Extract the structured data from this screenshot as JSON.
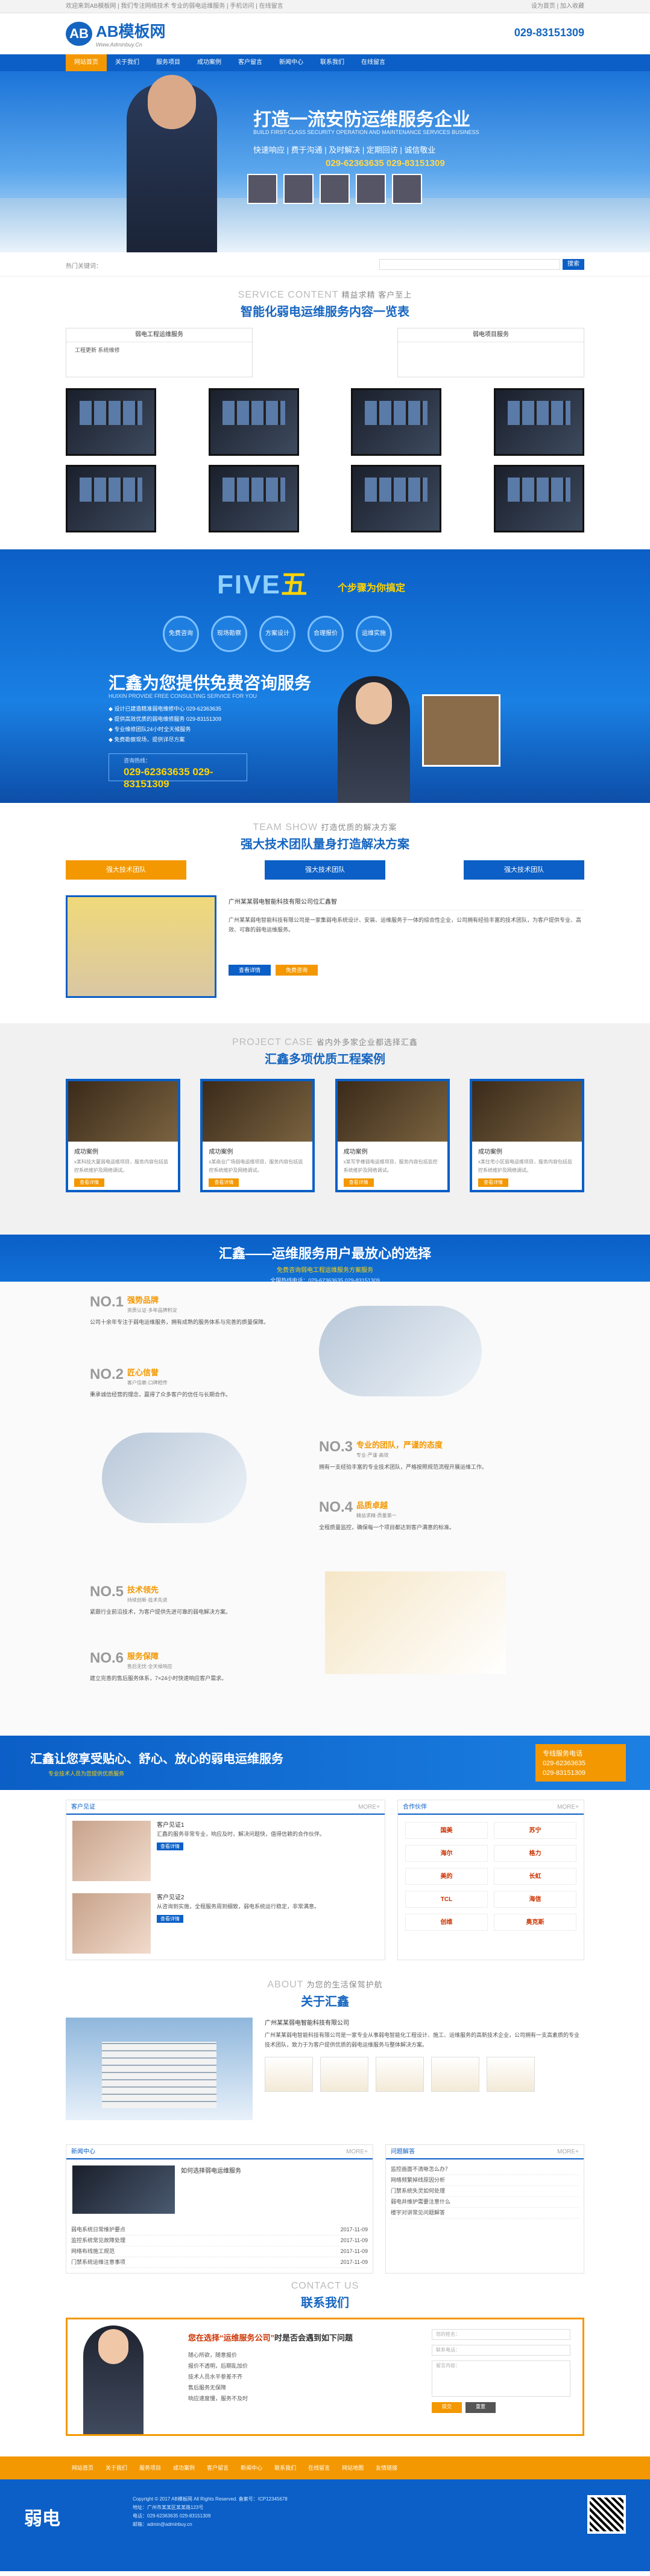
{
  "topbar": {
    "left": "欢迎来到AB模板网 | 我们专注网络技术 专业的弱电运维服务 | 手机访问 | 在线留言",
    "right": "设为首页 | 加入收藏"
  },
  "header": {
    "logo_text": "AB模板网",
    "logo_mark": "AB",
    "logo_sub": "Www.Adminbuy.Cn",
    "hotline": "029-83151309"
  },
  "nav": [
    "网站首页",
    "关于我们",
    "服务项目",
    "成功案例",
    "客户留言",
    "新闻中心",
    "联系我们",
    "在线留言"
  ],
  "banner": {
    "title": "打造一流安防运维服务企业",
    "subtitle": "BUILD FIRST-CLASS SECURITY OPERATION AND MAINTENANCE SERVICES BUSINESS",
    "features": "快速响应 | 费于沟通 | 及时解决 | 定期回访 | 诚信敬业",
    "phone": "029-62363635  029-83151309"
  },
  "search": {
    "label": "热门关键词：",
    "button": "搜索"
  },
  "service": {
    "en": "SERVICE CONTENT",
    "en_suffix": "精益求精 客户至上",
    "cn": "智能化弱电运维服务内容一览表",
    "col1": {
      "title": "弱电工程运维服务",
      "items": "工程更新    系统维修"
    },
    "col2": {
      "title": "弱电项目服务",
      "items": ""
    }
  },
  "five": {
    "big": "FIVE",
    "wu": "五",
    "line1": "个步骤为你搞定",
    "tag": "弱电运维服务",
    "steps": [
      "免费咨询",
      "现场勘察",
      "方案设计",
      "合理报价",
      "运维实施"
    ],
    "title": "汇鑫为您提供免费咨询服务",
    "title_en": "HUIXIN PROVIDE FREE CONSULTING SERVICE FOR YOU",
    "list": [
      "◆ 设计已建造精准弱电维修中心 029-62363635",
      "◆ 提供高效优质的弱电维修服务 029-83151309",
      "◆ 专业维修团队24小时全天候服务",
      "◆ 免费勘察现场，提供详尽方案"
    ],
    "tel_label": "咨询热线：",
    "tel": "029-62363635  029-83151309"
  },
  "team": {
    "en": "TEAM SHOW",
    "en_suffix": "打造优质的解决方案",
    "cn": "强大技术团队量身打造解决方案",
    "tabs": [
      "强大技术团队",
      "强大技术团队",
      "强大技术团队"
    ],
    "company": "广州某某弱电智能科技有限公司位汇鑫智",
    "desc": "广州某某弱电智能科技有限公司是一家集弱电系统设计、安装、运维服务于一体的综合性企业，公司拥有经验丰富的技术团队，为客户提供专业、高效、可靠的弱电运维服务。",
    "btn1": "查看详情",
    "btn2": "免费咨询"
  },
  "cases": {
    "en": "PROJECT CASE",
    "en_suffix": "省内外多家企业都选择汇鑫",
    "cn": "汇鑫多项优质工程案例",
    "items": [
      {
        "title": "成功案例",
        "desc": "x某科技大厦弱电运维项目，服务内容包括监控系统维护及网络调试。"
      },
      {
        "title": "成功案例",
        "desc": "x某商业广场弱电运维项目，服务内容包括监控系统维护及网络调试。"
      },
      {
        "title": "成功案例",
        "desc": "x某写字楼弱电运维项目，服务内容包括监控系统维护及网络调试。"
      },
      {
        "title": "成功案例",
        "desc": "x某住宅小区弱电运维项目，服务内容包括监控系统维护及网络调试。"
      }
    ],
    "more": "查看详情"
  },
  "why": {
    "a": "汇鑫——运维服务用户最放心的选择",
    "b": "免费咨询弱电工程运维服务方案服务",
    "c": "全国热线电话：029-62363635    029-83151309"
  },
  "nos": [
    {
      "no": "NO.1",
      "title": "强势品牌",
      "sub": "资质认证·多年品牌积淀",
      "desc": "公司十余年专注于弱电运维服务，拥有成熟的服务体系与完善的质量保障。"
    },
    {
      "no": "NO.2",
      "title": "匠心信誉",
      "sub": "客户信赖·口碑相传",
      "desc": "秉承诚信经营的理念，赢得了众多客户的信任与长期合作。"
    },
    {
      "no": "NO.3",
      "title": "专业的团队，严谨的态度",
      "sub": "专业·严谨·高效",
      "desc": "拥有一支经验丰富的专业技术团队，严格按照规范流程开展运维工作。"
    },
    {
      "no": "NO.4",
      "title": "品质卓越",
      "sub": "精益求精·质量第一",
      "desc": "全程质量监控，确保每一个项目都达到客户满意的标准。"
    },
    {
      "no": "NO.5",
      "title": "技术领先",
      "sub": "持续创新·技术先进",
      "desc": "紧跟行业前沿技术，为客户提供先进可靠的弱电解决方案。"
    },
    {
      "no": "NO.6",
      "title": "服务保障",
      "sub": "售后无忧·全天候响应",
      "desc": "建立完善的售后服务体系，7×24小时快速响应客户需求。"
    }
  ],
  "band": {
    "a": "汇鑫让您享受贴心、舒心、放心的弱电运维服务",
    "b": "专业技术人员为您提供优质服务",
    "c1": "专线服务电话",
    "c2": "029-62363635",
    "c3": "029-83151309"
  },
  "testimonials": {
    "title": "客户见证",
    "more": "MORE+",
    "items": [
      {
        "name": "客户见证1",
        "text": "汇鑫的服务非常专业，响应及时，解决问题快，值得信赖的合作伙伴。",
        "more": "查看详情"
      },
      {
        "name": "客户见证2",
        "text": "从咨询到实施，全程服务周到细致，弱电系统运行稳定，非常满意。",
        "more": "查看详情"
      }
    ]
  },
  "partners": {
    "title": "合作伙伴",
    "more": "MORE+",
    "logos": [
      "国美",
      "苏宁",
      "海尔",
      "格力",
      "美的",
      "长虹",
      "TCL",
      "海信",
      "创维",
      "奥克斯"
    ]
  },
  "about": {
    "en": "ABOUT",
    "en_suffix": "为您的生活保驾护航",
    "cn": "关于汇鑫",
    "company": "广州某某弱电智能科技有限公司",
    "desc": "广州某某弱电智能科技有限公司是一家专业从事弱电智能化工程设计、施工、运维服务的高新技术企业，公司拥有一支高素质的专业技术团队，致力于为客户提供优质的弱电运维服务与整体解决方案。"
  },
  "news": {
    "title": "新闻中心",
    "more": "MORE+",
    "lead": "如何选择弱电运维服务",
    "list": [
      {
        "t": "弱电系统日常维护要点",
        "d": "2017-11-09"
      },
      {
        "t": "监控系统常见故障处理",
        "d": "2017-11-09"
      },
      {
        "t": "网络布线施工规范",
        "d": "2017-11-09"
      },
      {
        "t": "门禁系统运维注意事项",
        "d": "2017-11-09"
      }
    ],
    "faq_title": "问题解答",
    "faq": [
      "监控画面不清晰怎么办？",
      "网络频繁掉线原因分析",
      "门禁系统失灵如何处理",
      "弱电井维护需要注意什么",
      "楼宇对讲常见问题解答"
    ]
  },
  "contact": {
    "en": "CONTACT US",
    "cn": "联系我们",
    "q1": "您在选择",
    "q2": "“运维服务公司”",
    "q3": "时是否会遇到如下问题",
    "lines": [
      "随心所欲，随意报价",
      "报价不透明，后期乱加价",
      "技术人员水平参差不齐",
      "售后服务无保障",
      "响应速度慢，服务不及时"
    ],
    "f1": "您的姓名：",
    "f2": "联系电话：",
    "f3": "留言内容：",
    "submit": "提交",
    "reset": "重置"
  },
  "footer": {
    "nav": [
      "网站首页",
      "关于我们",
      "服务项目",
      "成功案例",
      "客户留言",
      "新闻中心",
      "联系我们",
      "在线留言",
      "网站地图",
      "友情链接"
    ],
    "logo": "弱电",
    "text": [
      "Copyright © 2017 AB模板网 All Rights Reserved.  备案号：ICP12345678",
      "地址：广州市某某区某某路123号",
      "电话：029-62363635  029-83151309",
      "邮箱：admin@adminbuy.cn"
    ]
  }
}
